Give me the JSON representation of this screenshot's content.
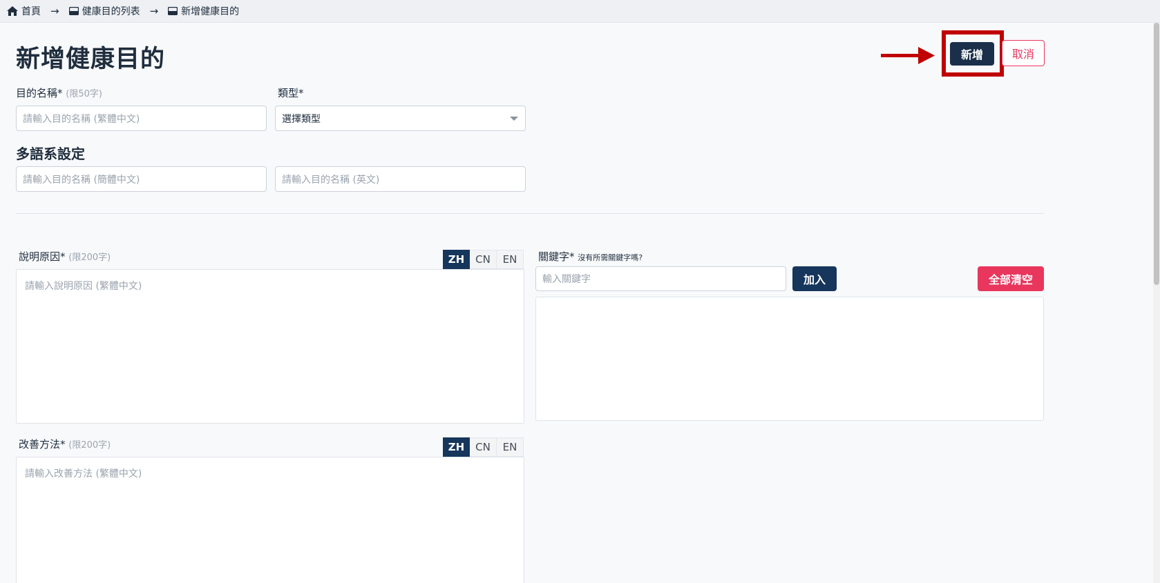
{
  "breadcrumb": {
    "home": "首頁",
    "list": "健康目的列表",
    "current": "新增健康目的",
    "separator": "→"
  },
  "page": {
    "title": "新增健康目的"
  },
  "actions": {
    "add_label": "新增",
    "cancel_label": "取消"
  },
  "form": {
    "name": {
      "label": "目的名稱*",
      "hint": "(限50字)",
      "placeholder": "請輸入目的名稱 (繁體中文)"
    },
    "type": {
      "label": "類型*",
      "selected": "選擇類型"
    },
    "multilang": {
      "title": "多語系設定",
      "simplified_placeholder": "請輸入目的名稱 (簡體中文)",
      "english_placeholder": "請輸入目的名稱 (英文)"
    },
    "reason": {
      "label": "說明原因*",
      "hint": "(限200字)",
      "placeholder": "請輸入說明原因 (繁體中文)"
    },
    "method": {
      "label": "改善方法*",
      "hint": "(限200字)",
      "placeholder": "請輸入改善方法 (繁體中文)"
    },
    "keyword": {
      "label": "關鍵字*",
      "help": "沒有所需關鍵字嗎?",
      "placeholder": "輸入關鍵字",
      "add_label": "加入",
      "clear_label": "全部清空"
    }
  },
  "lang_tabs": [
    "ZH",
    "CN",
    "EN"
  ],
  "colors": {
    "primary": "#16365c",
    "danger": "#e8365d",
    "highlight": "#c00000"
  }
}
